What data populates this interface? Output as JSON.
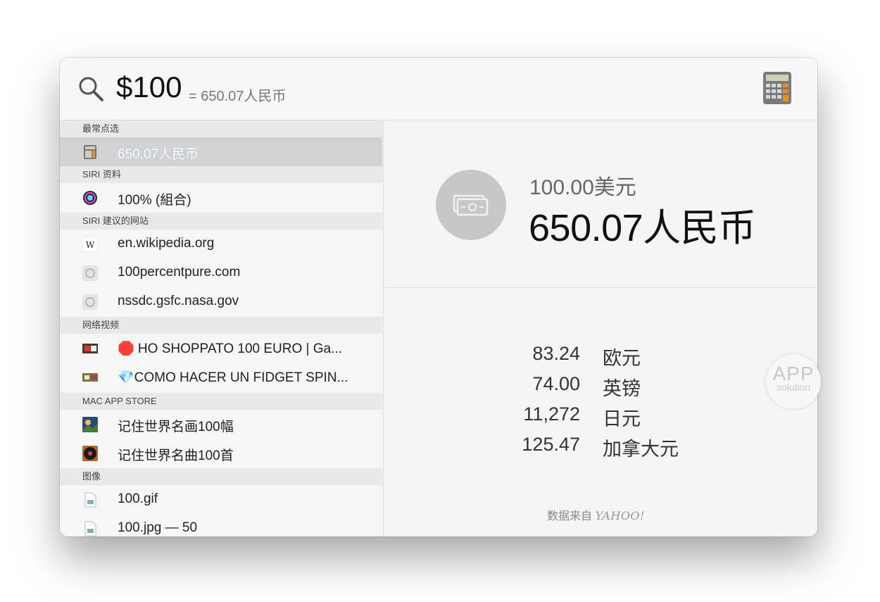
{
  "search": {
    "query": "$100",
    "inline_result": "= 650.07人民币",
    "app_icon": "calculator-icon"
  },
  "sections": [
    {
      "header": "最常点选",
      "items": [
        {
          "label": "650.07人民币",
          "icon": "calculator-icon",
          "selected": true
        }
      ]
    },
    {
      "header": "SIRI 资料",
      "items": [
        {
          "label": "100% (組合)",
          "icon": "siri-icon"
        }
      ]
    },
    {
      "header": "SIRI 建议的网站",
      "items": [
        {
          "label": "en.wikipedia.org",
          "icon": "wikipedia-icon"
        },
        {
          "label": "100percentpure.com",
          "icon": "compass-icon"
        },
        {
          "label": "nssdc.gsfc.nasa.gov",
          "icon": "compass-icon"
        }
      ]
    },
    {
      "header": "网络视频",
      "items": [
        {
          "label": "🛑 HO SHOPPATO 100 EURO | Ga...",
          "icon": "video-thumbnail"
        },
        {
          "label": "💎COMO HACER UN FIDGET SPIN...",
          "icon": "video-thumbnail"
        }
      ]
    },
    {
      "header": "MAC APP STORE",
      "items": [
        {
          "label": "记住世界名画100幅",
          "icon": "painting-app-icon"
        },
        {
          "label": "记住世界名曲100首",
          "icon": "vinyl-app-icon"
        }
      ]
    },
    {
      "header": "图像",
      "items": [
        {
          "label": "100.gif",
          "icon": "image-file-icon"
        },
        {
          "label": "100.jpg — 50",
          "icon": "image-file-icon"
        }
      ]
    }
  ],
  "detail": {
    "icon": "banknote-icon",
    "from": "100.00美元",
    "to": "650.07人民币",
    "rates": [
      {
        "value": "83.24",
        "currency": "欧元"
      },
      {
        "value": "74.00",
        "currency": "英镑"
      },
      {
        "value": "11,272",
        "currency": "日元"
      },
      {
        "value": "125.47",
        "currency": "加拿大元"
      }
    ],
    "source_prefix": "数据来自",
    "source_brand": "YAHOO!"
  },
  "watermark": {
    "line1": "APP",
    "line2": "solution"
  }
}
